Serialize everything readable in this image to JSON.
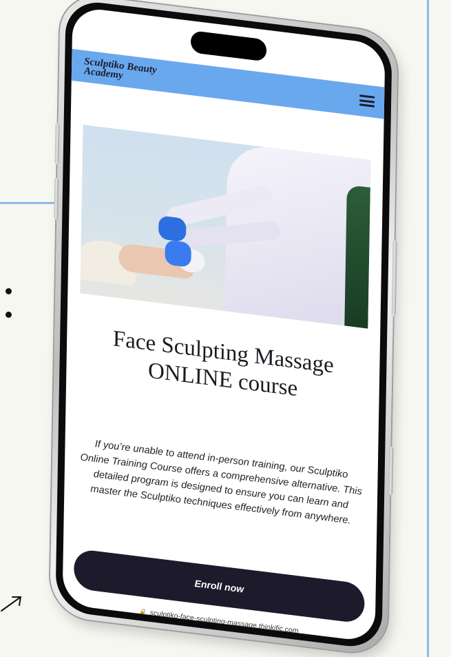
{
  "site": {
    "brand": "Sculptiko Beauty Academy",
    "header_color": "#6aa8ee"
  },
  "hero": {
    "image_subject": "massage-photo"
  },
  "course": {
    "title": "Face Sculpting Massage ONLINE course",
    "description": "If you’re unable to attend in-person training, our Sculptiko Online Training Course offers a comprehensive alternative. This detailed program is designed to ensure you can learn and master the Sculptiko techniques effectively from anywhere."
  },
  "cta": {
    "label": "Enroll now",
    "color": "#1d1b2b"
  },
  "browser": {
    "url": "sculptiko-face-sculpting-massage.thinkific.com",
    "lock_icon": "lock-icon"
  },
  "icons": {
    "menu": "hamburger-menu-icon"
  }
}
